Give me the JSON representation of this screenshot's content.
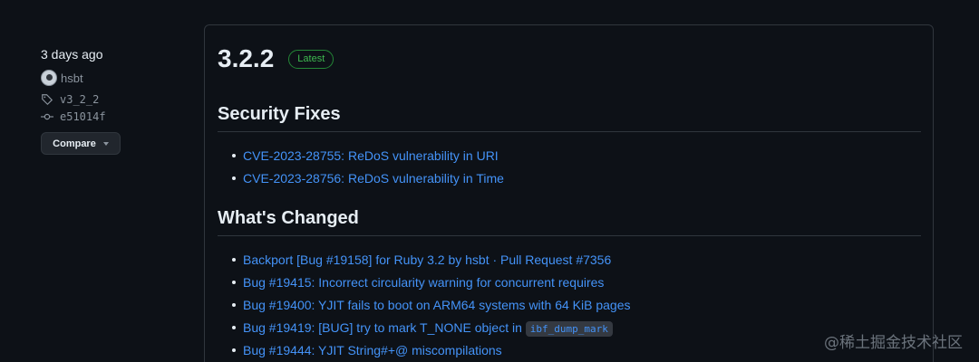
{
  "sidebar": {
    "date": "3 days ago",
    "author": "hsbt",
    "tag": "v3_2_2",
    "commit": "e51014f",
    "compare_label": "Compare"
  },
  "release": {
    "version": "3.2.2",
    "badge": "Latest",
    "sections": [
      {
        "heading": "Security Fixes",
        "items": [
          "CVE-2023-28755: ReDoS vulnerability in URI",
          "CVE-2023-28756: ReDoS vulnerability in Time"
        ]
      },
      {
        "heading": "What's Changed",
        "items": [
          "Backport [Bug #19158] for Ruby 3.2 by hsbt · Pull Request #7356",
          "Bug #19415: Incorrect circularity warning for concurrent requires",
          "Bug #19400: YJIT fails to boot on ARM64 systems with 64 KiB pages",
          "Bug #19419: [BUG] try to mark T_NONE object in ",
          "Bug #19444: YJIT String#+@ miscompilations"
        ],
        "code_snippet": "ibf_dump_mark"
      }
    ]
  },
  "watermark": "@稀土掘金技术社区",
  "icons": {
    "tag": "tag-icon",
    "commit": "git-commit-icon",
    "dropdown": "caret-down-icon"
  },
  "colors": {
    "background": "#0d1117",
    "border": "#30363d",
    "link": "#4493f8",
    "latest_badge": "#3fb950"
  }
}
